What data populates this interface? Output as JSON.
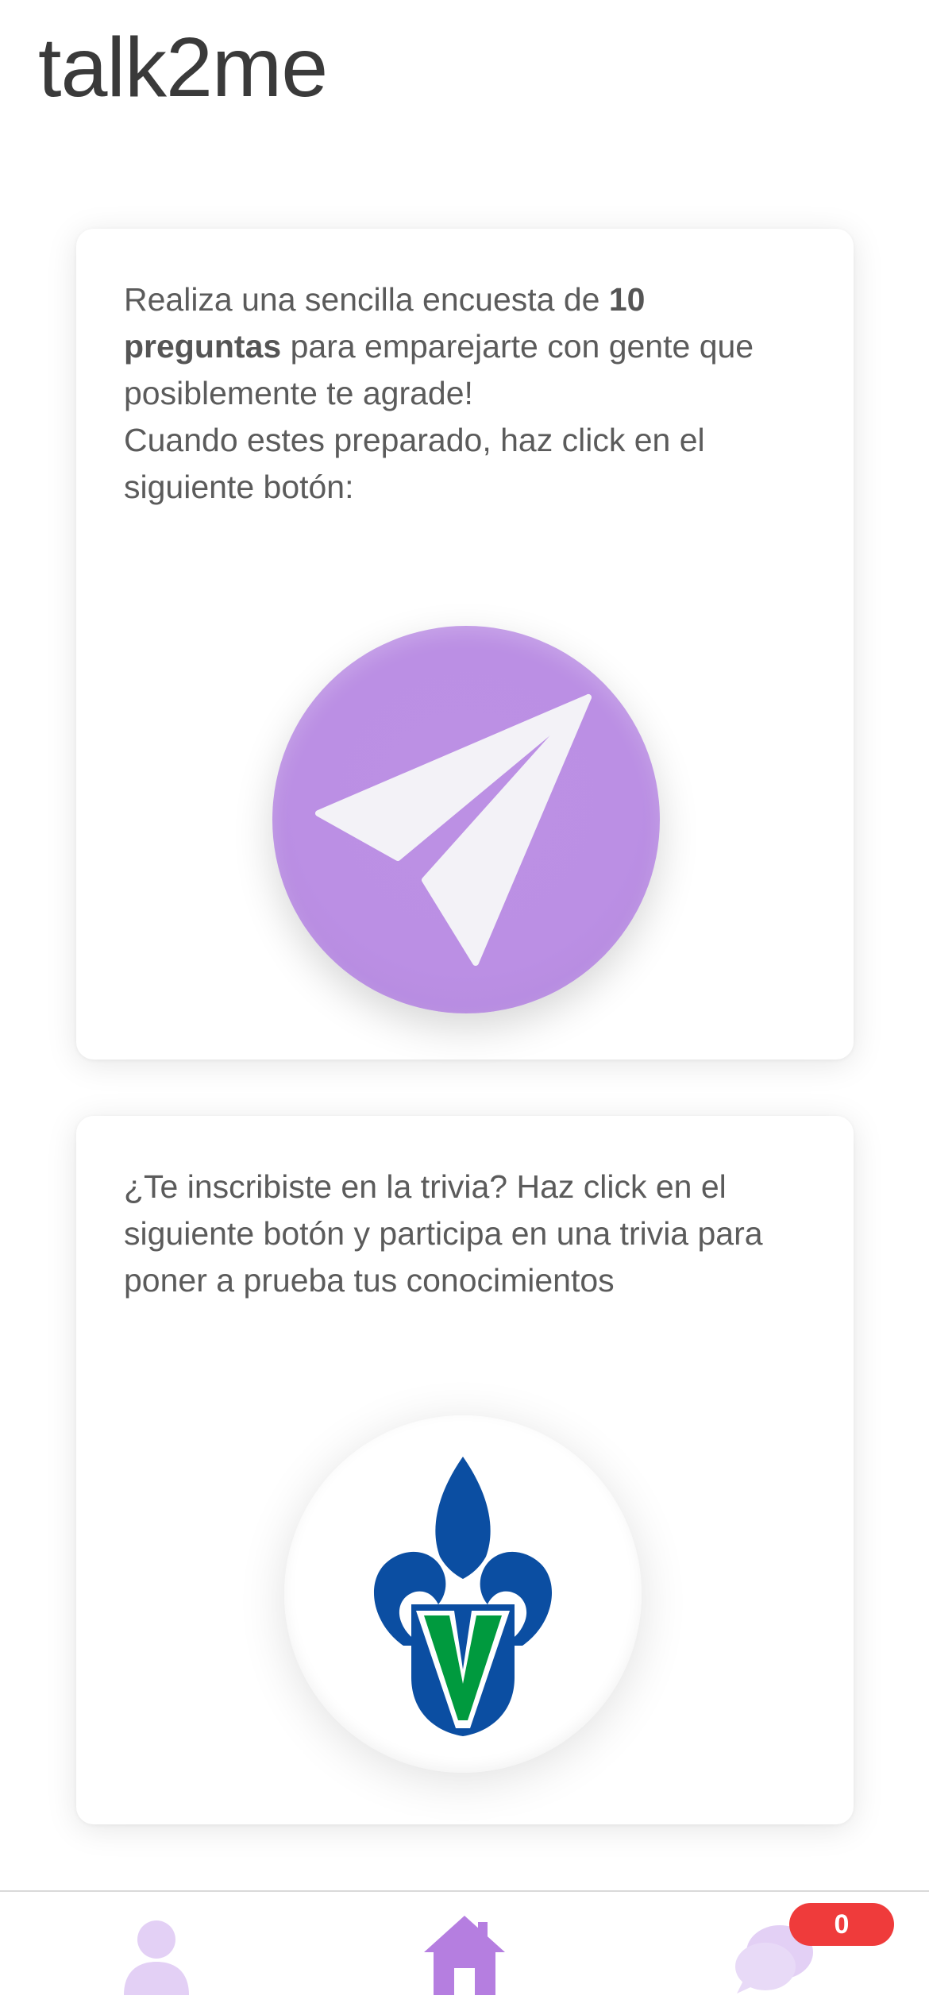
{
  "app": {
    "title": "talk2me"
  },
  "survey_card": {
    "text_before_bold": "Realiza una sencilla encuesta de ",
    "text_bold": "10 preguntas",
    "text_after_bold": " para emparejarte con gente que posiblemente te agrade!",
    "text_second": "Cuando estes preparado, haz click en el siguiente botón:",
    "button_icon": "paper-plane-icon",
    "button_color": "#BB8FE4"
  },
  "trivia_card": {
    "text": "¿Te inscribiste en la trivia? Haz click en el siguiente botón y participa en una trivia para poner a prueba tus conocimientos",
    "button_icon": "uv-logo-icon",
    "logo_colors": {
      "blue": "#0B4EA2",
      "green": "#009A3E"
    }
  },
  "tab_bar": {
    "items": [
      {
        "id": "profile",
        "icon": "user-icon",
        "active": false
      },
      {
        "id": "home",
        "icon": "home-icon",
        "active": true
      },
      {
        "id": "chat",
        "icon": "chat-bubbles-icon",
        "active": false
      }
    ],
    "chat_badge": "0",
    "active_color": "#B57EE0",
    "inactive_color": "#E3D0F5",
    "badge_color": "#EF3B3B"
  }
}
